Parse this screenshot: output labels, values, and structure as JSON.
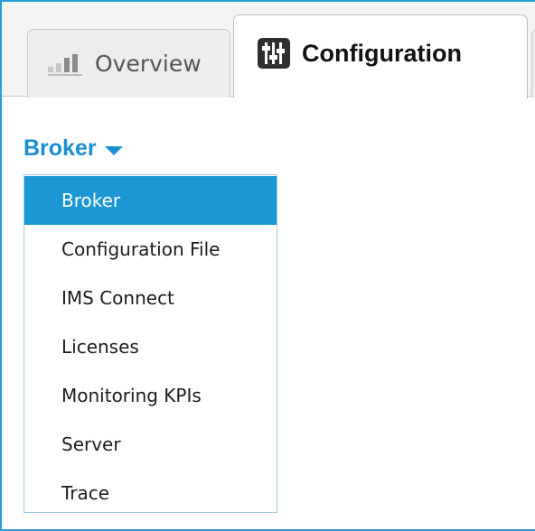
{
  "tabs": [
    {
      "label": "Overview",
      "icon": "bar-chart-icon",
      "active": false
    },
    {
      "label": "Configuration",
      "icon": "sliders-icon",
      "active": true
    }
  ],
  "broker_dropdown": {
    "label": "Broker",
    "selected": "Broker",
    "items": [
      {
        "label": "Broker"
      },
      {
        "label": "Configuration File"
      },
      {
        "label": "IMS Connect"
      },
      {
        "label": "Licenses"
      },
      {
        "label": "Monitoring KPIs"
      },
      {
        "label": "Server"
      },
      {
        "label": "Trace"
      }
    ]
  },
  "colors": {
    "accent": "#1c97d4",
    "frame": "#2a9fd6",
    "selected_text": "#ffffff"
  }
}
